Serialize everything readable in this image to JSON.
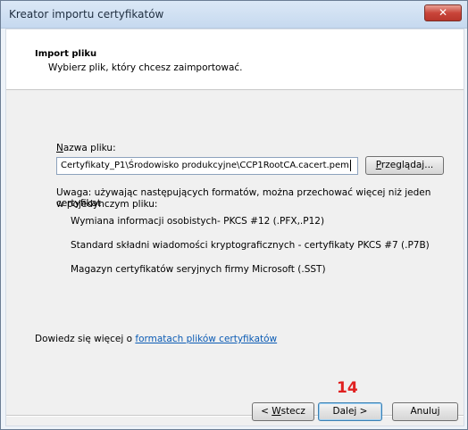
{
  "window": {
    "title": "Kreator importu certyfikatów",
    "close_glyph": "✕"
  },
  "header": {
    "title": "Import pliku",
    "subtitle": "Wybierz plik, który chcesz zaimportować."
  },
  "form": {
    "file_label_prefix": "N",
    "file_label_rest": "azwa pliku:",
    "file_value": "Certyfikaty_P1\\Środowisko produkcyjne\\CCP1RootCA.cacert.pem",
    "browse_prefix": "P",
    "browse_rest": "rzeglądaj..."
  },
  "note": {
    "line1": "Uwaga: używając następujących formatów, można przechować więcej niż jeden certyfikat",
    "line2": "w pojedynczym pliku:",
    "formats": [
      "Wymiana informacji osobistych- PKCS #12 (.PFX,.P12)",
      "Standard składni wiadomości kryptograficznych - certyfikaty PKCS #7 (.P7B)",
      "Magazyn certyfikatów seryjnych firmy Microsoft (.SST)"
    ]
  },
  "learn_more": {
    "text": "Dowiedz się więcej o ",
    "link": "formatach plików certyfikatów"
  },
  "annotation": {
    "step": "14",
    "color": "#e02020"
  },
  "footer": {
    "back_prefix": "< ",
    "back_accel": "W",
    "back_rest": "stecz",
    "next_label": "Dalej >",
    "cancel_label": "Anuluj"
  }
}
